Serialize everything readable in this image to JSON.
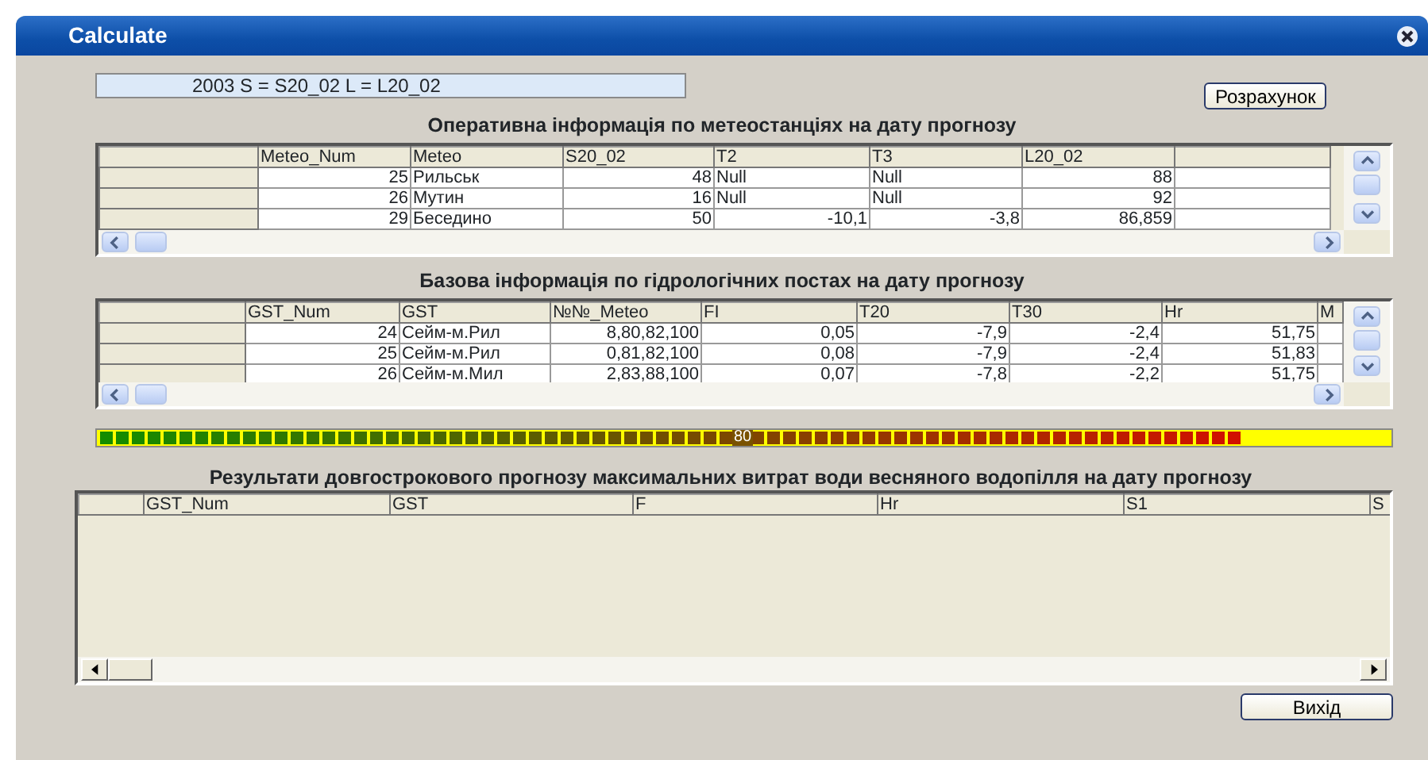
{
  "window": {
    "title": "Calculate"
  },
  "parameters": "2003    S =  S20_02    L =  L20_02",
  "calculate_button": "Розрахунок",
  "meteo_section": {
    "title": "Оперативна інформація по метеостанціях на дату прогнозу",
    "columns": [
      "",
      "Meteo_Num",
      "Meteo",
      "S20_02",
      "T2",
      "T3",
      "L20_02",
      ""
    ],
    "rows": [
      [
        "",
        "25",
        "Рильськ",
        "48",
        "Null",
        "Null",
        "88",
        ""
      ],
      [
        "",
        "26",
        "Мутин",
        "16",
        "Null",
        "Null",
        "92",
        ""
      ],
      [
        "",
        "29",
        "Беседино",
        "50",
        "-10,1",
        "-3,8",
        "86,859",
        ""
      ]
    ]
  },
  "hydro_section": {
    "title": "Базова інформація по гідрологічних постах на дату прогнозу",
    "columns": [
      "",
      "GST_Num",
      "GST",
      "№№_Meteo",
      "FI",
      "T20",
      "T30",
      "Hr",
      "M"
    ],
    "rows": [
      [
        "",
        "24",
        "Сейм-м.Рил",
        "8,80,82,100",
        "0,05",
        "-7,9",
        "-2,4",
        "51,75",
        ""
      ],
      [
        "",
        "25",
        "Сейм-м.Рил",
        "0,81,82,100",
        "0,08",
        "-7,9",
        "-2,4",
        "51,83",
        ""
      ],
      [
        "",
        "26",
        "Сейм-м.Мил",
        "2,83,88,100",
        "0,07",
        "-7,8",
        "-2,2",
        "51,75",
        ""
      ]
    ]
  },
  "progress": {
    "level": 0.9,
    "reading": "80"
  },
  "results_section": {
    "title": "Результати довгострокового прогнозу максимальних витрат води весняного водопілля на дату прогнозу",
    "columns": [
      "",
      "GST_Num",
      "GST",
      "F",
      "Hr",
      "S1",
      "S"
    ]
  },
  "exit_button": "Вихід"
}
